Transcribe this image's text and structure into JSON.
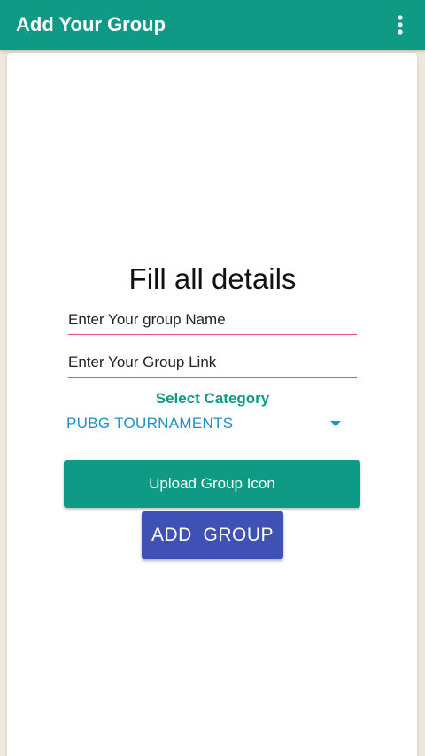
{
  "app_bar": {
    "title": "Add Your Group",
    "menu_icon": "more-vert-icon",
    "color": "#0f9a85"
  },
  "form": {
    "heading": "Fill all details",
    "name_placeholder": "Enter Your group Name",
    "link_placeholder": "Enter Your Group Link",
    "category_label": "Select Category",
    "category_selected": "PUBG TOURNAMENTS",
    "upload_button": "Upload Group Icon",
    "submit_button": "ADD  GROUP"
  },
  "colors": {
    "accent": "#0f9a85",
    "primary_button": "#3f51b5",
    "underline": "#e0517f",
    "spinner_text": "#1f8fc9"
  }
}
